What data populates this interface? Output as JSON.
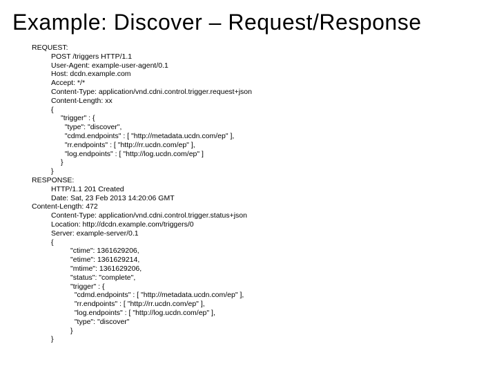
{
  "title": "Example: Discover – Request/Response",
  "request": {
    "label": "REQUEST:",
    "lines": [
      "POST /triggers HTTP/1.1",
      "User-Agent: example-user-agent/0.1",
      "Host: dcdn.example.com",
      "Accept: */*",
      "Content-Type: application/vnd.cdni.control.trigger.request+json",
      "Content-Length: xx",
      "{"
    ],
    "body_inner": [
      "\"trigger\" : {",
      "  \"type\": \"discover\",",
      "  \"cdmd.endpoints\" : [ \"http://metadata.ucdn.com/ep\" ],",
      "  \"rr.endpoints\" : [ \"http://rr.ucdn.com/ep\" ],",
      "  \"log.endpoints\" : [ \"http://log.ucdn.com/ep\" ]",
      "}"
    ],
    "close": "}"
  },
  "response": {
    "label": "RESPONSE:",
    "lines1": [
      "HTTP/1.1 201 Created",
      "Date: Sat, 23 Feb 2013 14:20:06 GMT"
    ],
    "cl_label": "Content-Length: 472",
    "lines2": [
      "Content-Type: application/vnd.cdni.control.trigger.status+json",
      "Location: http://dcdn.example.com/triggers/0",
      "Server: example-server/0.1",
      "{"
    ],
    "body_inner": [
      "\"ctime\": 1361629206,",
      "\"etime\": 1361629214,",
      "\"mtime\": 1361629206,",
      "\"status\": \"complete\",",
      "\"trigger\" : {",
      "  \"cdmd.endpoints\" : [ \"http://metadata.ucdn.com/ep\" ],",
      "  \"rr.endpoints\" : [ \"http://rr.ucdn.com/ep\" ],",
      "  \"log.endpoints\" : [ \"http://log.ucdn.com/ep\" ],",
      "  \"type\": \"discover\"",
      "}"
    ],
    "close": "}"
  }
}
